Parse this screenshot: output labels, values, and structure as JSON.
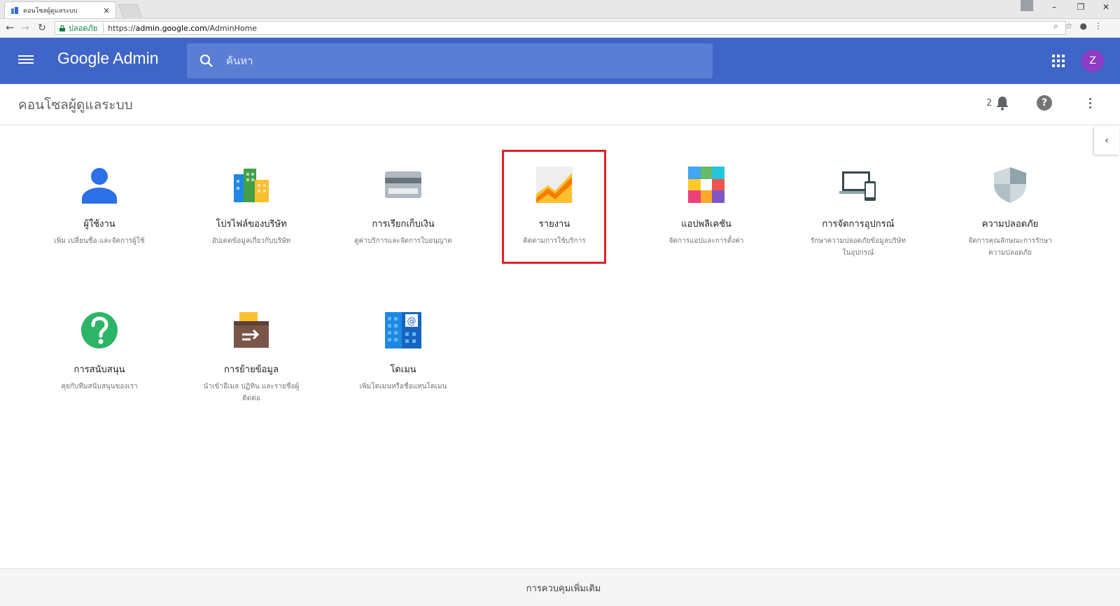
{
  "browser": {
    "tab_title": "คอนโซลผู้ดูแลระบบ",
    "tab_close": "×",
    "secure_label": "ปลอดภัย",
    "url_scheme": "https://",
    "url_host": "admin.google.com",
    "url_path": "/AdminHome",
    "window_minimize": "–",
    "window_restore": "❐",
    "window_close": "✕"
  },
  "header": {
    "brand": "Google Admin",
    "search_placeholder": "ค้นหา",
    "avatar_initial": "Z"
  },
  "subheader": {
    "title": "คอนโซลผู้ดูแลระบบ",
    "notification_count": "2"
  },
  "tiles": [
    {
      "label": "ผู้ใช้งาน",
      "desc": "เพิ่ม เปลี่ยนชื่อ และจัดการผู้ใช้"
    },
    {
      "label": "โปรไฟล์ของบริษัท",
      "desc": "อัปเดตข้อมูลเกี่ยวกับบริษัท"
    },
    {
      "label": "การเรียกเก็บเงิน",
      "desc": "ดูค่าบริการและจัดการใบอนุญาต"
    },
    {
      "label": "รายงาน",
      "desc": "ติดตามการใช้บริการ"
    },
    {
      "label": "แอปพลิเคชัน",
      "desc": "จัดการแอปและการตั้งค่า"
    },
    {
      "label": "การจัดการอุปกรณ์",
      "desc": "รักษาความปลอดภัยข้อมูลบริษัทในอุปกรณ์"
    },
    {
      "label": "ความปลอดภัย",
      "desc": "จัดการคุณลักษณะการรักษาความปลอดภัย"
    },
    {
      "label": "การสนับสนุน",
      "desc": "คุยกับทีมสนับสนุนของเรา"
    },
    {
      "label": "การย้ายข้อมูล",
      "desc": "นำเข้าอีเมล ปฏิทิน และรายชื่อผู้ติดต่อ"
    },
    {
      "label": "โดเมน",
      "desc": "เพิ่มโดเมนหรือชื่อแทนโดเมน"
    }
  ],
  "footer": {
    "more_controls": "การควบคุมเพิ่มเติม"
  },
  "colors": {
    "appbar": "#3f65c8",
    "avatar": "#8e3cc1",
    "highlight": "#e32027"
  }
}
